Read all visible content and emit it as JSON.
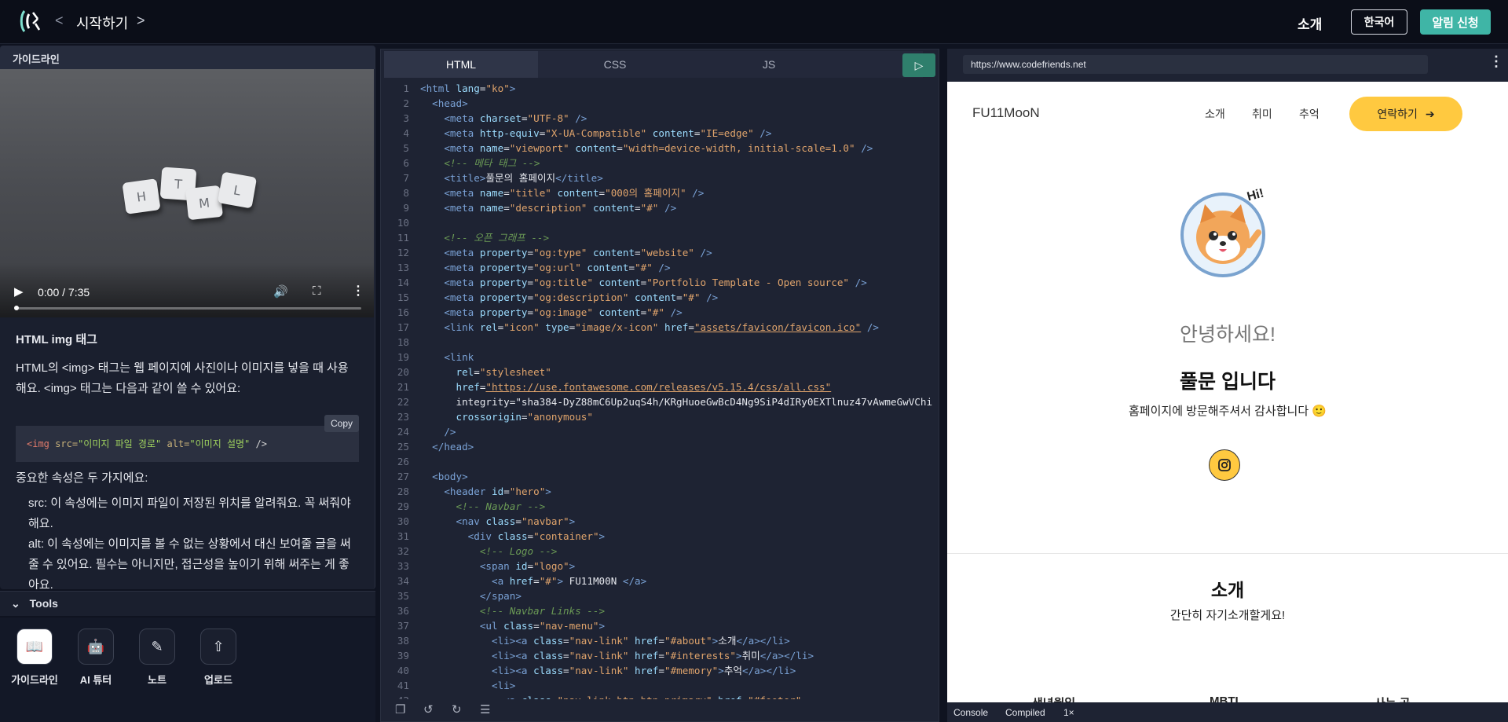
{
  "header": {
    "breadcrumb_prev": "<",
    "title": "시작하기",
    "breadcrumb_next": ">",
    "intro": "소개",
    "lang": "한국어",
    "alert": "알림 신청"
  },
  "left": {
    "panel_title": "가이드라인",
    "video": {
      "tiles": [
        "H",
        "T",
        "M",
        "L"
      ],
      "time": "0:00 / 7:35",
      "progress": 0.0
    },
    "guide": {
      "heading": "HTML img 태그",
      "p1": "HTML의 <img> 태그는 웹 페이지에 사진이나 이미지를 넣을 때 사용해요. <img> 태그는 다음과 같이 쓸 수 있어요:",
      "copy": "Copy",
      "code": {
        "open": "<",
        "tag": "img",
        "src_attr": "src=",
        "src_val": "\"이미지 파일 경로\"",
        "alt_attr": "alt=",
        "alt_val": "\"이미지 설명\"",
        "close": " />"
      },
      "p2": "중요한 속성은 두 가지에요:",
      "items": [
        "src: 이 속성에는 이미지 파일이 저장된 위치를 알려줘요. 꼭 써줘야 해요.",
        "alt: 이 속성에는 이미지를 볼 수 없는 상황에서 대신 보여줄 글을 써줄 수 있어요. 필수는 아니지만, 접근성을 높이기 위해 써주는 게 좋아요."
      ]
    },
    "tools_title": "Tools",
    "tools": [
      {
        "label": "가이드라인",
        "icon": "book-icon"
      },
      {
        "label": "AI 튜터",
        "icon": "robot-icon"
      },
      {
        "label": "노트",
        "icon": "note-icon"
      },
      {
        "label": "업로드",
        "icon": "upload-icon"
      }
    ]
  },
  "editor": {
    "tabs": [
      "HTML",
      "CSS",
      "JS"
    ],
    "active_tab": "HTML",
    "lines": [
      "<html lang=\"ko\">",
      "  <head>",
      "    <meta charset=\"UTF-8\" />",
      "    <meta http-equiv=\"X-UA-Compatible\" content=\"IE=edge\" />",
      "    <meta name=\"viewport\" content=\"width=device-width, initial-scale=1.0\" />",
      "    <!-- 메타 태그 -->",
      "    <title>풀문의 홈페이지</title>",
      "    <meta name=\"title\" content=\"000의 홈페이지\" />",
      "    <meta name=\"description\" content=\"#\" />",
      "",
      "    <!-- 오픈 그래프 -->",
      "    <meta property=\"og:type\" content=\"website\" />",
      "    <meta property=\"og:url\" content=\"#\" />",
      "    <meta property=\"og:title\" content=\"Portfolio Template - Open source\" />",
      "    <meta property=\"og:description\" content=\"#\" />",
      "    <meta property=\"og:image\" content=\"#\" />",
      "    <link rel=\"icon\" type=\"image/x-icon\" href=\"assets/favicon/favicon.ico\" />",
      "",
      "    <link",
      "      rel=\"stylesheet\"",
      "      href=\"https://use.fontawesome.com/releases/v5.15.4/css/all.css\"",
      "      integrity=\"sha384-DyZ88mC6Up2uqS4h/KRgHuoeGwBcD4Ng9SiP4dIRy0EXTlnuz47vAwmeGwVChi",
      "      crossorigin=\"anonymous\"",
      "    />",
      "  </head>",
      "",
      "  <body>",
      "    <header id=\"hero\">",
      "      <!-- Navbar -->",
      "      <nav class=\"navbar\">",
      "        <div class=\"container\">",
      "          <!-- Logo -->",
      "          <span id=\"logo\">",
      "            <a href=\"#\"> FU11M00N </a>",
      "          </span>",
      "          <!-- Navbar Links -->",
      "          <ul class=\"nav-menu\">",
      "            <li><a class=\"nav-link\" href=\"#about\">소개</a></li>",
      "            <li><a class=\"nav-link\" href=\"#interests\">취미</a></li>",
      "            <li><a class=\"nav-link\" href=\"#memory\">추억</a></li>",
      "            <li>",
      "              <a class=\"nav-link btn btn-primary\" href=\"#footer\""
    ]
  },
  "preview": {
    "url": "https://www.codefriends.net",
    "logo": "FU11MooN",
    "nav": [
      "소개",
      "취미",
      "추억"
    ],
    "contact": "연락하기",
    "hi": "Hi!",
    "hello": "안녕하세요!",
    "name": "풀문 입니다",
    "thanks": "홈페이지에 방문해주셔서 감사합니다 🙂",
    "about_title": "소개",
    "about_sub": "간단히 자기소개할게요!",
    "cut_items": [
      "생년월일",
      "MBTI",
      "사는 곳"
    ],
    "footer": [
      "Console",
      "Compiled",
      "1×"
    ]
  },
  "colors": {
    "accent": "#3fb5a6",
    "run": "#2f7f6c",
    "yellow": "#ffc940"
  }
}
